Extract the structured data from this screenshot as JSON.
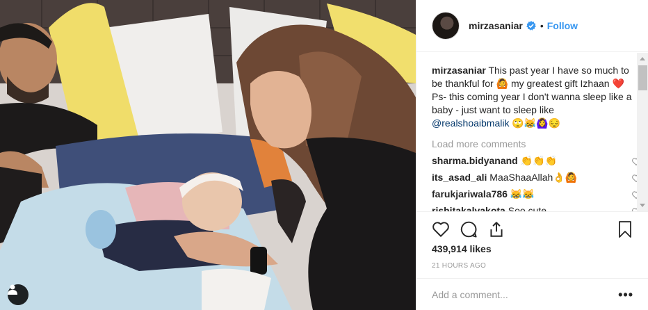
{
  "post": {
    "author": "mirzasaniar",
    "follow_label": "Follow",
    "separator": "•",
    "caption": {
      "user": "mirzasaniar",
      "text_1": "This past year I have so much to be thankful for",
      "emoji_1": "🙆",
      "text_2": "my greatest gift Izhaan",
      "emoji_2": "❤️",
      "text_3": "Ps- this coming year I don't wanna sleep like a baby - just want to sleep like",
      "mention": "@realshoaibmalik",
      "emoji_3": "🙄😹🙆‍♀️😔"
    },
    "load_more": "Load more comments",
    "comments": [
      {
        "user": "sharma.bidyanand",
        "text": "👏👏👏"
      },
      {
        "user": "its_asad_ali",
        "text": "MaaShaaAllah👌🙆"
      },
      {
        "user": "farukjariwala786",
        "text": "😹😹"
      },
      {
        "user": "rishitakalvakota",
        "text": "Soo cute"
      }
    ],
    "likes": "439,914 likes",
    "timestamp": "21 HOURS AGO",
    "comment_placeholder": "Add a comment...",
    "more_options": "•••"
  },
  "colors": {
    "accent": "#3897f0",
    "text": "#262626",
    "muted": "#999999",
    "verified": "#3897f0"
  },
  "icons": [
    "verified-badge-icon",
    "heart-icon",
    "comment-icon",
    "share-icon",
    "bookmark-icon",
    "user-tag-icon"
  ]
}
